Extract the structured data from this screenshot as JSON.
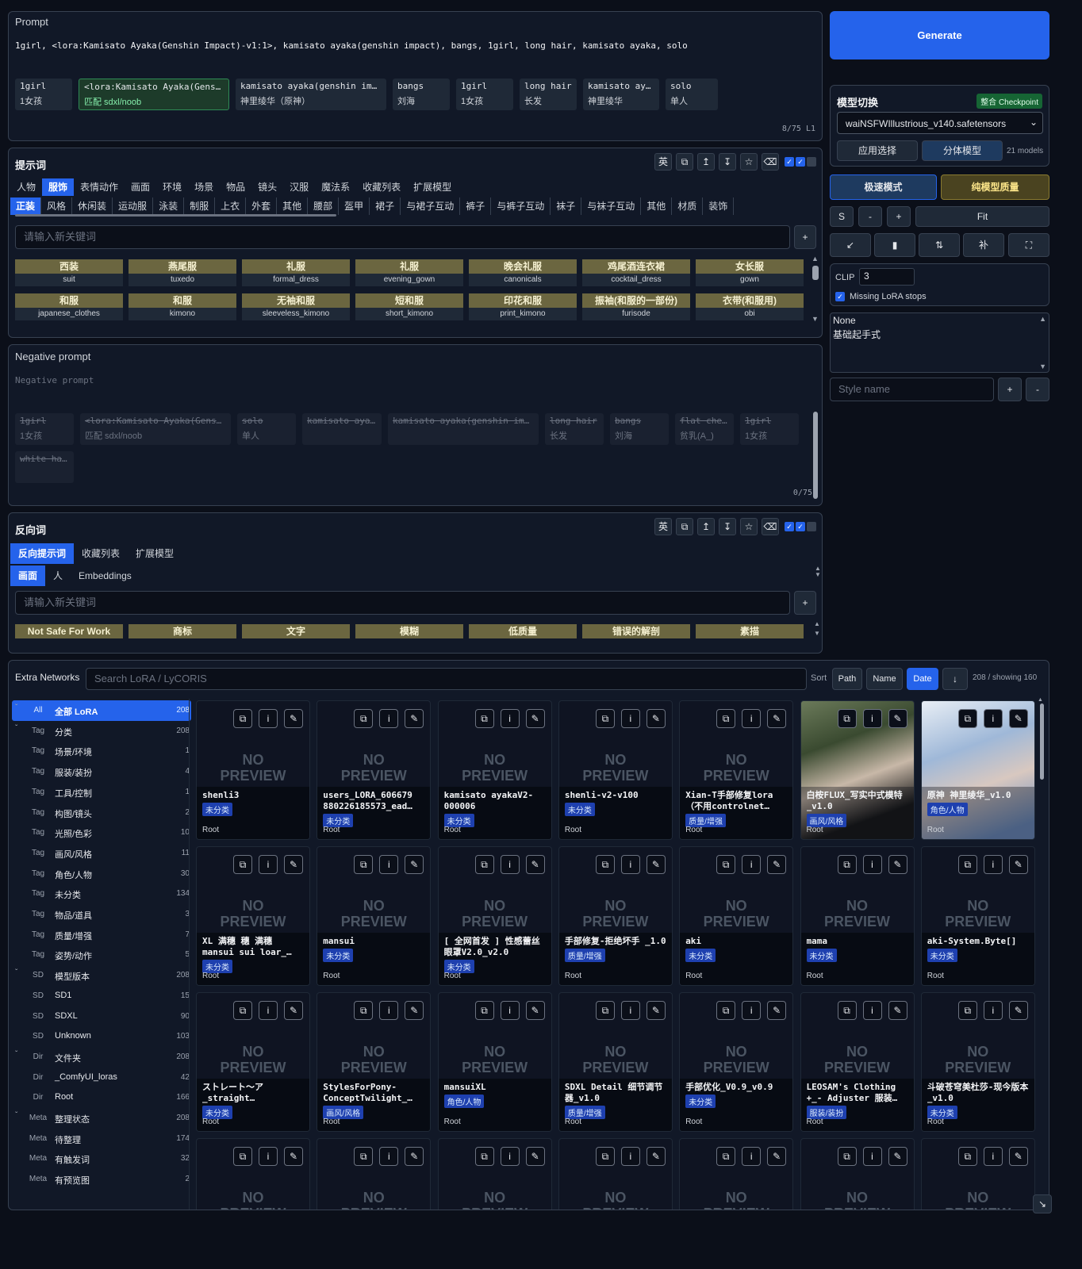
{
  "prompt": {
    "label": "Prompt",
    "text": "1girl, <lora:Kamisato Ayaka(Genshin Impact)-v1:1>, kamisato ayaka(genshin impact), bangs, 1girl, long hair, kamisato ayaka, solo",
    "counter": "8/75 L1",
    "chips": [
      {
        "en": "1girl",
        "zh": "1女孩"
      },
      {
        "en": "<lora:Kamisato Ayaka(Genshin Impact)-v1:1>",
        "zh": "匹配 sdxl/noob",
        "green": true
      },
      {
        "en": "kamisato ayaka(genshin impact)",
        "zh": "神里绫华（原神）"
      },
      {
        "en": "bangs",
        "zh": "刘海"
      },
      {
        "en": "1girl",
        "zh": "1女孩"
      },
      {
        "en": "long hair",
        "zh": "长发"
      },
      {
        "en": "kamisato ayaka",
        "zh": "神里绫华"
      },
      {
        "en": "solo",
        "zh": "单人"
      }
    ]
  },
  "generate": "Generate",
  "model": {
    "title": "模型切换",
    "badge": "整合 Checkpoint",
    "selected": "waiNSFWIllustrious_v140.safetensors",
    "apply": "应用选择",
    "split": "分体模型",
    "count": "21 models",
    "fast": "极速模式",
    "quality": "纯模型质量",
    "s": "S",
    "minus": "-",
    "plus": "+",
    "fit": "Fit",
    "clip_label": "CLIP",
    "clip_value": "3",
    "missing_lora": "Missing LoRA stops",
    "styles": [
      "None",
      "基础起手式"
    ],
    "style_placeholder": "Style name"
  },
  "tags": {
    "title": "提示词",
    "tool_en": "英",
    "cats": [
      "人物",
      "服饰",
      "表情动作",
      "画面",
      "环境",
      "场景",
      "物品",
      "镜头",
      "汉服",
      "魔法系",
      "收藏列表",
      "扩展模型"
    ],
    "subcats": [
      "正装",
      "风格",
      "休闲装",
      "运动服",
      "泳装",
      "制服",
      "上衣",
      "外套",
      "其他",
      "腰部",
      "盔甲",
      "裙子",
      "与裙子互动",
      "裤子",
      "与裤子互动",
      "袜子",
      "与袜子互动",
      "其他",
      "材质",
      "装饰"
    ],
    "placeholder": "请输入新关键词",
    "keywords": [
      {
        "zh": "西装",
        "en": "suit"
      },
      {
        "zh": "燕尾服",
        "en": "tuxedo"
      },
      {
        "zh": "礼服",
        "en": "formal_dress"
      },
      {
        "zh": "礼服",
        "en": "evening_gown"
      },
      {
        "zh": "晚会礼服",
        "en": "canonicals"
      },
      {
        "zh": "鸡尾酒连衣裙",
        "en": "cocktail_dress"
      },
      {
        "zh": "女长服",
        "en": "gown"
      },
      {
        "zh": "和服",
        "en": "japanese_clothes"
      },
      {
        "zh": "和服",
        "en": "kimono"
      },
      {
        "zh": "无袖和服",
        "en": "sleeveless_kimono"
      },
      {
        "zh": "短和服",
        "en": "short_kimono"
      },
      {
        "zh": "印花和服",
        "en": "print_kimono"
      },
      {
        "zh": "振袖(和服的一部份)",
        "en": "furisode"
      },
      {
        "zh": "衣带(和服用)",
        "en": "obi"
      }
    ]
  },
  "negative": {
    "label": "Negative prompt",
    "placeholder": "Negative prompt",
    "counter": "0/75",
    "chips": [
      {
        "en": "1girl",
        "zh": "1女孩"
      },
      {
        "en": "<lora:Kamisato Ayaka(Genshin Impact)-v1:1>",
        "zh": "匹配 sdxl/noob"
      },
      {
        "en": "solo",
        "zh": "单人"
      },
      {
        "en": "kamisato ayaka",
        "zh": ""
      },
      {
        "en": "kamisato ayaka(genshin impact)",
        "zh": ""
      },
      {
        "en": "long hair",
        "zh": "长发"
      },
      {
        "en": "bangs",
        "zh": "刘海"
      },
      {
        "en": "flat chest",
        "zh": "贫乳(A_)"
      },
      {
        "en": "1girl",
        "zh": "1女孩"
      },
      {
        "en": "white hair",
        "zh": ""
      }
    ]
  },
  "negtags": {
    "title": "反向词",
    "tabs": [
      "反向提示词",
      "收藏列表",
      "扩展模型"
    ],
    "subtabs": [
      "画面",
      "人",
      "Embeddings"
    ],
    "placeholder": "请输入新关键词",
    "keywords": [
      "Not Safe For Work",
      "商标",
      "文字",
      "模糊",
      "低质量",
      "错误的解剖",
      "素描"
    ]
  },
  "extra": {
    "label": "Extra Networks",
    "search": "Search LoRA / LyCORIS",
    "sort": "Sort",
    "path": "Path",
    "name": "Name",
    "date": "Date",
    "arrow": "↓",
    "count": "208 / showing 160",
    "tree": [
      {
        "t": "All",
        "n": "全部 LoRA",
        "c": "208",
        "sel": true,
        "car": "▾"
      },
      {
        "t": "Tag",
        "n": "分类",
        "c": "208",
        "car": "›"
      },
      {
        "t": "Tag",
        "n": "场景/环境",
        "c": "1"
      },
      {
        "t": "Tag",
        "n": "服装/装扮",
        "c": "4"
      },
      {
        "t": "Tag",
        "n": "工具/控制",
        "c": "1"
      },
      {
        "t": "Tag",
        "n": "构图/镜头",
        "c": "2"
      },
      {
        "t": "Tag",
        "n": "光照/色彩",
        "c": "10"
      },
      {
        "t": "Tag",
        "n": "画风/风格",
        "c": "11"
      },
      {
        "t": "Tag",
        "n": "角色/人物",
        "c": "30"
      },
      {
        "t": "Tag",
        "n": "未分类",
        "c": "134"
      },
      {
        "t": "Tag",
        "n": "物品/道具",
        "c": "3"
      },
      {
        "t": "Tag",
        "n": "质量/增强",
        "c": "7"
      },
      {
        "t": "Tag",
        "n": "姿势/动作",
        "c": "5"
      },
      {
        "t": "SD",
        "n": "模型版本",
        "c": "208",
        "car": "›"
      },
      {
        "t": "SD",
        "n": "SD1",
        "c": "15"
      },
      {
        "t": "SD",
        "n": "SDXL",
        "c": "90"
      },
      {
        "t": "SD",
        "n": "Unknown",
        "c": "103"
      },
      {
        "t": "Dir",
        "n": "文件夹",
        "c": "208",
        "car": "›"
      },
      {
        "t": "Dir",
        "n": "_ComfyUI_loras",
        "c": "42"
      },
      {
        "t": "Dir",
        "n": "Root",
        "c": "166"
      },
      {
        "t": "Meta",
        "n": "整理状态",
        "c": "208",
        "car": "›"
      },
      {
        "t": "Meta",
        "n": "待整理",
        "c": "174"
      },
      {
        "t": "Meta",
        "n": "有触发词",
        "c": "32"
      },
      {
        "t": "Meta",
        "n": "有预览图",
        "c": "2"
      }
    ],
    "no_preview": "NO PREVIEW",
    "root": "Root",
    "cards": [
      {
        "n": "shenli3",
        "tag": "未分类"
      },
      {
        "n": "users_LORA_606679 880226185573_ead…",
        "tag": "未分类"
      },
      {
        "n": "kamisato ayakaV2-000006",
        "tag": "未分类"
      },
      {
        "n": "shenli-v2-v100",
        "tag": "未分类"
      },
      {
        "n": "Xian-T手部修复lora（不用controlnet…",
        "tag": "质量/增强"
      },
      {
        "n": "白桉FLUX_写实中式模特_v1.0",
        "tag": "画风/风格",
        "photo": 1
      },
      {
        "n": "原神 神里绫华_v1.0",
        "tag": "角色/人物",
        "photo": 2
      },
      {
        "n": "XL 满穗 穗 满穗 mansui sui loar_…",
        "tag": "未分类"
      },
      {
        "n": "mansui",
        "tag": "未分类"
      },
      {
        "n": "[ 全网首发 ] 性感蕾丝眼罩V2.0_v2.0",
        "tag": "未分类"
      },
      {
        "n": "手部修复-拒绝坏手 _1.0",
        "tag": "质量/增强"
      },
      {
        "n": "aki",
        "tag": "未分类"
      },
      {
        "n": "mama",
        "tag": "未分类"
      },
      {
        "n": "aki-System.Byte[]",
        "tag": "未分类"
      },
      {
        "n": "ストレート～ア _straight…",
        "tag": "未分类"
      },
      {
        "n": "StylesForPony-ConceptTwilight_…",
        "tag": "画风/风格"
      },
      {
        "n": "mansuiXL",
        "tag": "角色/人物"
      },
      {
        "n": "SDXL Detail 细节调节器_v1.0",
        "tag": "质量/增强"
      },
      {
        "n": "手部优化_V0.9_v0.9",
        "tag": "未分类"
      },
      {
        "n": "LEOSAM's Clothing +_- Adjuster 服装…",
        "tag": "服装/装扮"
      },
      {
        "n": "斗破苍穹美杜莎-现今版本_v1.0",
        "tag": "未分类"
      }
    ]
  }
}
